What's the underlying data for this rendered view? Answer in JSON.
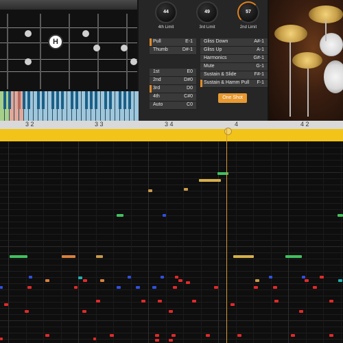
{
  "knobs": [
    {
      "value": "44",
      "label": "4th Limit"
    },
    {
      "value": "49",
      "label": "3rd Limit"
    },
    {
      "value": "57",
      "label": "2nd Limit"
    }
  ],
  "articulations_left": [
    {
      "label": "Pull",
      "key": "E-1",
      "selected": true
    },
    {
      "label": "Thumb",
      "key": "D#-1",
      "selected": false
    }
  ],
  "articulations_right": [
    {
      "label": "Gliss Down",
      "key": "A#-1",
      "selected": false
    },
    {
      "label": "Gliss Up",
      "key": "A-1",
      "selected": false
    },
    {
      "label": "Harmonics",
      "key": "G#-1",
      "selected": false
    },
    {
      "label": "Mute",
      "key": "G-1",
      "selected": false
    },
    {
      "label": "Sustain & Slide",
      "key": "F#-1",
      "selected": false
    },
    {
      "label": "Sustain & Hamm Pull",
      "key": "F-1",
      "selected": true
    }
  ],
  "positions": [
    {
      "label": "1st",
      "key": "E0",
      "selected": false
    },
    {
      "label": "2nd",
      "key": "D#0",
      "selected": false
    },
    {
      "label": "3rd",
      "key": "D0",
      "selected": true
    },
    {
      "label": "4th",
      "key": "C#0",
      "selected": false
    },
    {
      "label": "Auto",
      "key": "C0",
      "selected": false
    }
  ],
  "fret_marker": "H",
  "one_shot_label": "One Shot",
  "ruler": [
    "3 2",
    "3 3",
    "3 4",
    "4",
    "4 2"
  ],
  "colors": {
    "accent_orange": "#e79a32",
    "loop_bar": "#f2c41a",
    "note_red": "#e02a2a"
  }
}
